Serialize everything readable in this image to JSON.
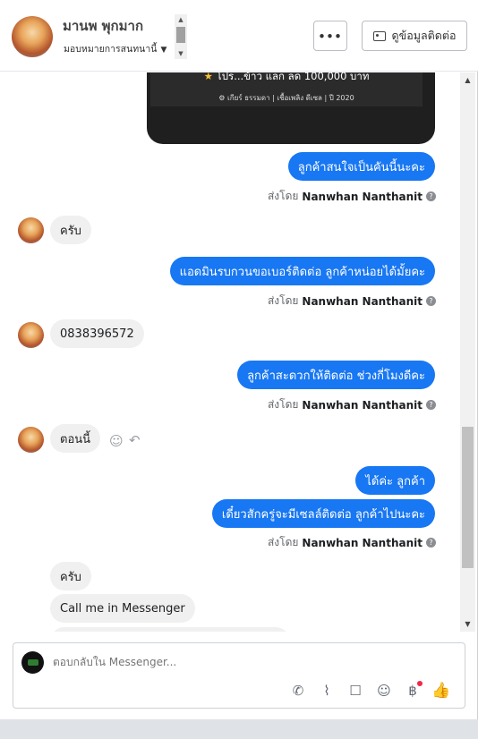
{
  "header": {
    "contact_name": "มานพ พุกมาก",
    "assign_label": "มอบหมายการสนทนานี้",
    "more_label": "•••",
    "contact_button_label": "ดูข้อมูลติดต่อ"
  },
  "promo": {
    "line1": "โปร...ข้าว แลก ลด 100,000 บาท",
    "line2": "⚙ เกียร์ ธรรมดา   |   เชื้อเพลิง ดีเซล   |   ปี 2020"
  },
  "messages": {
    "m1": "ลูกค้าสนใจเป็นคันนี้นะคะ",
    "m2": "ครับ",
    "m3": "แอดมินรบกวนขอเบอร์ติดต่อ ลูกค้าหน่อยได้มั้ยคะ",
    "m4": "0838396572",
    "m5": "ลูกค้าสะดวกให้ติดต่อ ช่วงกี่โมงดีคะ",
    "m6": "ตอนนี้",
    "m7": "ได้ค่ะ ลูกค้า",
    "m8": "เดี๋ยวสักครู่จะมีเซลล์ติดต่อ ลูกค้าไปนะคะ",
    "m9": "ครับ",
    "m10": "Call me in Messenger"
  },
  "sent_by": {
    "prefix": "ส่งโดย",
    "name": "Nanwhan Nanthanit"
  },
  "composer": {
    "placeholder": "ตอบกลับใน Messenger..."
  },
  "icons": {
    "more": "more-dots-icon",
    "contact_card": "contact-card-icon",
    "emoji": "smile-icon",
    "reply": "reply-icon",
    "call": "phone-icon",
    "attach": "paperclip-icon",
    "saved_replies": "chat-bubble-icon",
    "emoji_picker": "smile-icon",
    "payment": "baht-icon",
    "like": "thumbs-up-icon"
  },
  "colors": {
    "outgoing_bubble": "#1877f2",
    "incoming_bubble": "#f0f0f0",
    "notification_dot": "#f0284a"
  }
}
